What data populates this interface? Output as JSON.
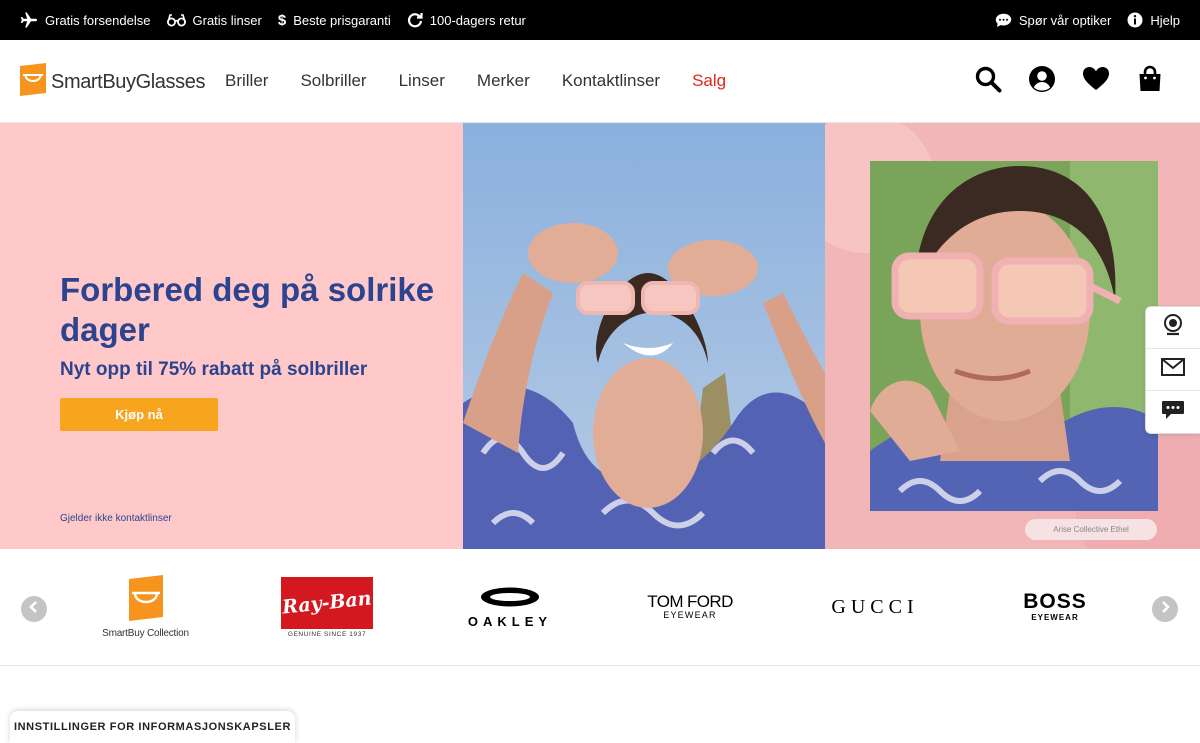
{
  "topbar": {
    "left_items": [
      {
        "icon": "airplane-icon",
        "label": "Gratis forsendelse"
      },
      {
        "icon": "glasses-icon",
        "label": "Gratis linser"
      },
      {
        "icon": "dollar-icon",
        "label": "Beste prisgaranti"
      },
      {
        "icon": "return-arrow-icon",
        "label": "100-dagers retur"
      }
    ],
    "right_items": [
      {
        "icon": "chat-icon",
        "label": "Spør vår optiker"
      },
      {
        "icon": "info-icon",
        "label": "Hjelp"
      }
    ]
  },
  "header": {
    "logo_text": "SmartBuyGlasses",
    "nav": [
      "Briller",
      "Solbriller",
      "Linser",
      "Merker",
      "Kontaktlinser",
      "Salg"
    ],
    "icons": [
      "search-icon",
      "account-icon",
      "heart-icon",
      "bag-icon"
    ]
  },
  "hero": {
    "title": "Forbered deg på solrike dager",
    "subtitle": "Nyt opp til 75% rabatt på solbriller",
    "cta": "Kjøp nå",
    "note": "Gjelder ikke kontaktlinser",
    "caption": "Arise Collective Ethel"
  },
  "side_widget": [
    "webcam-icon",
    "mail-icon",
    "chat-bubble-icon"
  ],
  "brands": {
    "smartbuy_caption": "SmartBuy Collection",
    "rayban_main": "Ray-Ban",
    "rayban_sub": "GENUINE SINCE 1937",
    "oakley": "OAKLEY",
    "tomford_main": "TOM FORD",
    "tomford_sub": "EYEWEAR",
    "gucci": "GUCCI",
    "boss_main": "BOSS",
    "boss_sub": "EYEWEAR"
  },
  "cookie": {
    "label": "INNSTILLINGER FOR INFORMASJONSKAPSLER"
  },
  "colors": {
    "accent_blue": "#2c4490",
    "cta_orange": "#f7a51c",
    "sale_red": "#e1251b",
    "hero_pink": "#ffc9c9"
  }
}
